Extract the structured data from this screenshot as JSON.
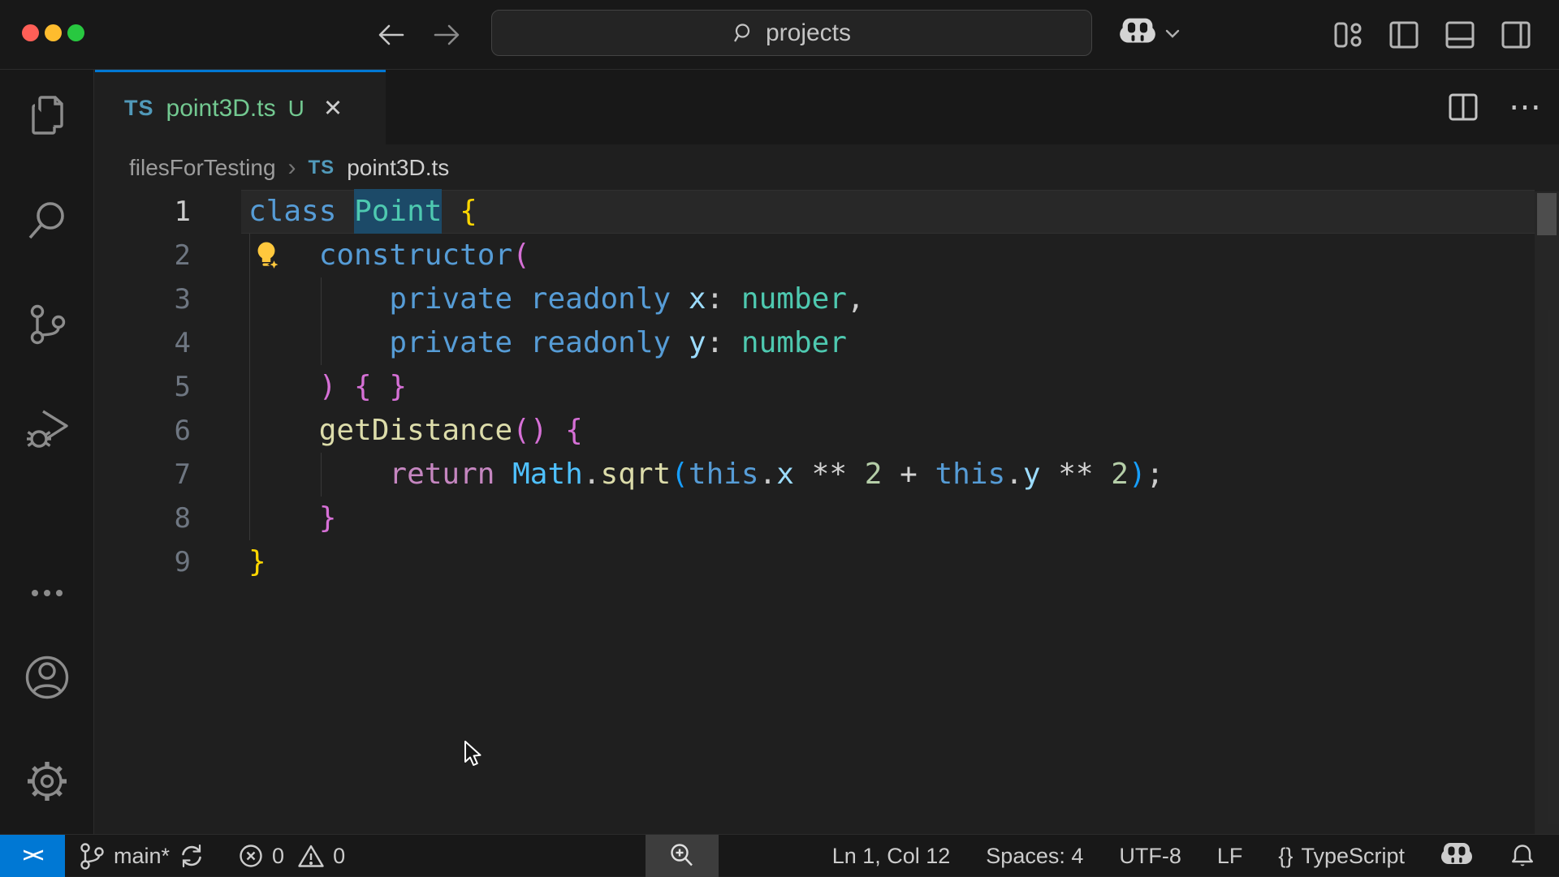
{
  "colors": {
    "accent_blue": "#0078D4",
    "editor_bg": "#1f1f1f",
    "chrome_bg": "#181818",
    "untracked_green": "#73C991",
    "ts_icon_blue": "#519ABA",
    "traffic_red": "#FF5F57",
    "traffic_yellow": "#FEBC2E",
    "traffic_green": "#28C840"
  },
  "titlebar": {
    "command_center_text": "projects"
  },
  "editor": {
    "tab": {
      "ts_icon": "TS",
      "title": "point3D.ts",
      "badge": "U",
      "close_glyph": "✕"
    },
    "actions_more_glyph": "⋯",
    "breadcrumb": {
      "folder": "filesForTesting",
      "separator": "›",
      "ts_icon": "TS",
      "file": "point3D.ts"
    },
    "code": {
      "default_color": "#CCCCCC",
      "lines": [
        {
          "num": "1",
          "active": true,
          "tokens": [
            {
              "t": "class",
              "c": "#569CD6"
            },
            {
              "t": " "
            },
            {
              "t": "Point",
              "c": "#4EC9B0",
              "hl": true
            },
            {
              "t": " "
            },
            {
              "t": "{",
              "c": "#FFD700"
            }
          ]
        },
        {
          "num": "2",
          "bulb": true,
          "tokens": [
            {
              "t": "    "
            },
            {
              "t": "constructor",
              "c": "#569CD6"
            },
            {
              "t": "(",
              "c": "#D670D6"
            }
          ]
        },
        {
          "num": "3",
          "tokens": [
            {
              "t": "        "
            },
            {
              "t": "private",
              "c": "#569CD6"
            },
            {
              "t": " "
            },
            {
              "t": "readonly",
              "c": "#569CD6"
            },
            {
              "t": " "
            },
            {
              "t": "x",
              "c": "#9CDCFE"
            },
            {
              "t": ": "
            },
            {
              "t": "number",
              "c": "#4EC9B0"
            },
            {
              "t": ","
            }
          ]
        },
        {
          "num": "4",
          "tokens": [
            {
              "t": "        "
            },
            {
              "t": "private",
              "c": "#569CD6"
            },
            {
              "t": " "
            },
            {
              "t": "readonly",
              "c": "#569CD6"
            },
            {
              "t": " "
            },
            {
              "t": "y",
              "c": "#9CDCFE"
            },
            {
              "t": ": "
            },
            {
              "t": "number",
              "c": "#4EC9B0"
            }
          ]
        },
        {
          "num": "5",
          "tokens": [
            {
              "t": "    "
            },
            {
              "t": ") { }",
              "c": "#D670D6"
            }
          ]
        },
        {
          "num": "6",
          "tokens": [
            {
              "t": "    "
            },
            {
              "t": "getDistance",
              "c": "#DCDCAA"
            },
            {
              "t": "()",
              "c": "#D670D6"
            },
            {
              "t": " "
            },
            {
              "t": "{",
              "c": "#D670D6"
            }
          ]
        },
        {
          "num": "7",
          "tokens": [
            {
              "t": "        "
            },
            {
              "t": "return",
              "c": "#C586C0"
            },
            {
              "t": " "
            },
            {
              "t": "Math",
              "c": "#4FC1FF"
            },
            {
              "t": "."
            },
            {
              "t": "sqrt",
              "c": "#DCDCAA"
            },
            {
              "t": "(",
              "c": "#179FFF"
            },
            {
              "t": "this",
              "c": "#569CD6"
            },
            {
              "t": "."
            },
            {
              "t": "x",
              "c": "#9CDCFE"
            },
            {
              "t": " "
            },
            {
              "t": "**",
              "c": "#D4D4D4"
            },
            {
              "t": " "
            },
            {
              "t": "2",
              "c": "#B5CEA8"
            },
            {
              "t": " "
            },
            {
              "t": "+",
              "c": "#D4D4D4"
            },
            {
              "t": " "
            },
            {
              "t": "this",
              "c": "#569CD6"
            },
            {
              "t": "."
            },
            {
              "t": "y",
              "c": "#9CDCFE"
            },
            {
              "t": " "
            },
            {
              "t": "**",
              "c": "#D4D4D4"
            },
            {
              "t": " "
            },
            {
              "t": "2",
              "c": "#B5CEA8"
            },
            {
              "t": ")",
              "c": "#179FFF"
            },
            {
              "t": ";"
            }
          ]
        },
        {
          "num": "8",
          "tokens": [
            {
              "t": "    "
            },
            {
              "t": "}",
              "c": "#D670D6"
            }
          ]
        },
        {
          "num": "9",
          "tokens": [
            {
              "t": "}",
              "c": "#FFD700"
            }
          ]
        }
      ]
    }
  },
  "statusbar": {
    "remote_glyph": "><",
    "branch": "main*",
    "errors_count": "0",
    "warnings_count": "0",
    "line_col": "Ln 1, Col 12",
    "indent": "Spaces: 4",
    "encoding": "UTF-8",
    "eol": "LF",
    "braces_glyph": "{}",
    "language": "TypeScript"
  }
}
